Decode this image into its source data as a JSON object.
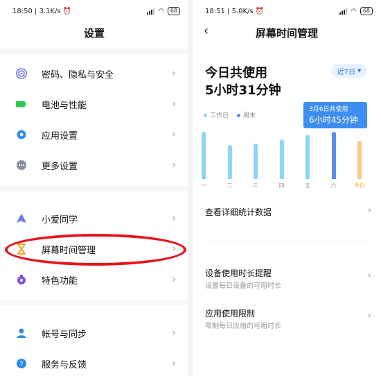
{
  "left_screen": {
    "status": {
      "time": "18:50",
      "speed": "3.1K/s",
      "battery": "68"
    },
    "title": "设置",
    "groups": [
      [
        {
          "label": "密码、隐私与安全",
          "icon": "fingerprint-icon",
          "color": "#6c6fe0"
        },
        {
          "label": "电池与性能",
          "icon": "battery-icon",
          "color": "#2fc45a"
        },
        {
          "label": "应用设置",
          "icon": "gear-icon",
          "color": "#2b8cf0"
        },
        {
          "label": "更多设置",
          "icon": "more-dots-icon",
          "color": "#8a8fa6"
        }
      ],
      [
        {
          "label": "小爱同学",
          "icon": "xiaoai-icon",
          "color": "#4f7bf7"
        },
        {
          "label": "屏幕时间管理",
          "icon": "hourglass-icon",
          "color": "#f5a623"
        },
        {
          "label": "特色功能",
          "icon": "feature-icon",
          "color": "#7a55d6"
        }
      ],
      [
        {
          "label": "帐号与同步",
          "icon": "person-icon",
          "color": "#2b8cf0"
        },
        {
          "label": "服务与反馈",
          "icon": "help-icon",
          "color": "#2b8cf0"
        }
      ]
    ]
  },
  "right_screen": {
    "status": {
      "time": "18:51",
      "speed": "5.0K/s",
      "battery": "68"
    },
    "title": "屏幕时间管理",
    "today_label": "今日共使用",
    "today_value": "5小时31分钟",
    "range": "近7日",
    "legend": [
      {
        "label": "工作日",
        "color": "#8fd3f7"
      },
      {
        "label": "周末",
        "color": "#5a8cf2"
      }
    ],
    "tooltip": {
      "date": "3月6日共使用",
      "value": "6小时45分钟"
    },
    "chart_data": {
      "type": "bar",
      "categories": [
        "一",
        "二",
        "三",
        "四",
        "五",
        "六",
        "今日"
      ],
      "series_kind": [
        "工作日",
        "工作日",
        "工作日",
        "工作日",
        "工作日",
        "周末",
        "今日"
      ],
      "values": [
        6.8,
        4.9,
        5.1,
        5.7,
        6.4,
        6.75,
        5.52
      ],
      "colors": [
        "#8fd3f7",
        "#8fd3f7",
        "#8fd3f7",
        "#8fd3f7",
        "#8fd3f7",
        "#5a8cf2",
        "#f7c88a"
      ],
      "ylim": [
        0,
        8
      ],
      "unit": "hours"
    },
    "rows": [
      {
        "main": "查看详细统计数据",
        "sub": ""
      },
      {
        "main": "设备使用时长提醒",
        "sub": "设置每日设备的可用时长"
      },
      {
        "main": "应用使用限制",
        "sub": "限制每日应用的可用时长"
      }
    ]
  }
}
